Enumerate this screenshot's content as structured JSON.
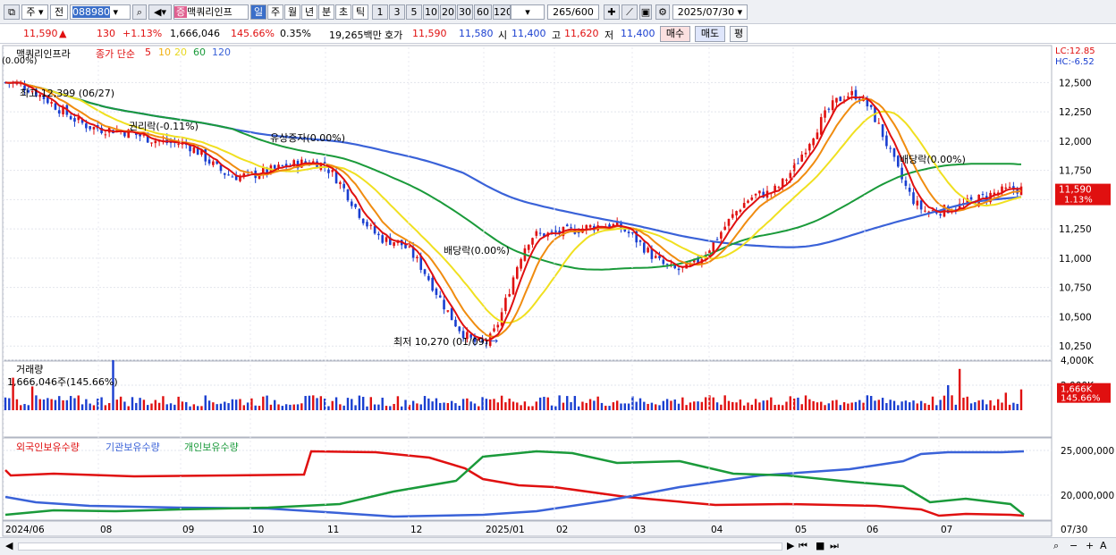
{
  "toolbar": {
    "period": "주",
    "type": "전",
    "code": "088980",
    "name": "맥쿼리인프",
    "tabs": [
      "일",
      "주",
      "월",
      "년",
      "분",
      "초",
      "틱"
    ],
    "active_tab": "일",
    "nums": [
      "1",
      "3",
      "5",
      "10",
      "20",
      "30",
      "60",
      "120"
    ],
    "count": "265",
    "total": "/600",
    "date": "2025/07/30",
    "sep": "|"
  },
  "info": {
    "price": "11,590",
    "arrow": "▲",
    "change": "130",
    "pct": "+1.13%",
    "volume": "1,666,046",
    "vol_ratio": "145.66%",
    "turnover": "0.35%",
    "amount": "19,265백만",
    "quote_lbl": "호가",
    "ask": "11,590",
    "bid": "11,580",
    "open_lbl": "시",
    "open": "11,400",
    "high_lbl": "고",
    "high": "11,620",
    "low_lbl": "저",
    "low": "11,400",
    "buy": "매수",
    "sell": "매도",
    "eval": "평"
  },
  "price_panel": {
    "title": "맥쿼리인프라",
    "ma_lbl": "종가 단순",
    "ma": [
      "5",
      "10",
      "20",
      "60",
      "120"
    ],
    "lc": "LC:12.85",
    "hc": "HC:-6.52",
    "yticks": [
      "12,500",
      "12,250",
      "12,000",
      "11,750",
      "11,500",
      "11,250",
      "11,000",
      "10,750",
      "10,500",
      "10,250"
    ],
    "cur": "11,590",
    "cur_pct": "1.13%",
    "max_lbl": "최고 12,399 (06/27)",
    "min_lbl": "최저 10,270 (01/09)",
    "ev1": "권리락(-0.11%)",
    "ev2": "유상증자(0.00%)",
    "ev3": "배당락(0.00%)",
    "ev4": "배당락(0.00%)",
    "ev0": "(0.00%)"
  },
  "vol_panel": {
    "title": "거래량",
    "val": "1,666,046주(145.66%)",
    "yticks": [
      "4,000K",
      "2,000K"
    ],
    "cur": "1,666K",
    "cur_pct": "145.66%"
  },
  "own_panel": {
    "t1": "외국인보유수량",
    "t2": "기관보유수량",
    "t3": "개인보유수량",
    "yticks": [
      "25,000,000",
      "20,000,000"
    ]
  },
  "xaxis": [
    "2024/06",
    "08",
    "09",
    "10",
    "11",
    "12",
    "2025/01",
    "02",
    "03",
    "04",
    "05",
    "06",
    "07",
    "07/30"
  ],
  "colors": {
    "up": "#e01010",
    "down": "#1a3fd0",
    "ma5": "#e01010",
    "ma10": "#f08c10",
    "ma20": "#f0e020",
    "ma60": "#1a9a3a",
    "ma120": "#3a62d8"
  },
  "chart_data": {
    "type": "candlestick",
    "ylim": [
      10160,
      12800
    ],
    "keypoints": [
      [
        "2024/06",
        12500
      ],
      [
        "2024/08",
        12100
      ],
      [
        "2024/09",
        11980
      ],
      [
        "2024/10",
        11700
      ],
      [
        "2024/11",
        11820
      ],
      [
        "2024/12",
        11150
      ],
      [
        "2025/01/09",
        10270
      ],
      [
        "2025/02",
        11200
      ],
      [
        "2025/03",
        11280
      ],
      [
        "2025/04",
        10900
      ],
      [
        "2025/05",
        11550
      ],
      [
        "2025/06/27",
        12399
      ],
      [
        "2025/07",
        11400
      ],
      [
        "2025/07/30",
        11590
      ]
    ]
  }
}
